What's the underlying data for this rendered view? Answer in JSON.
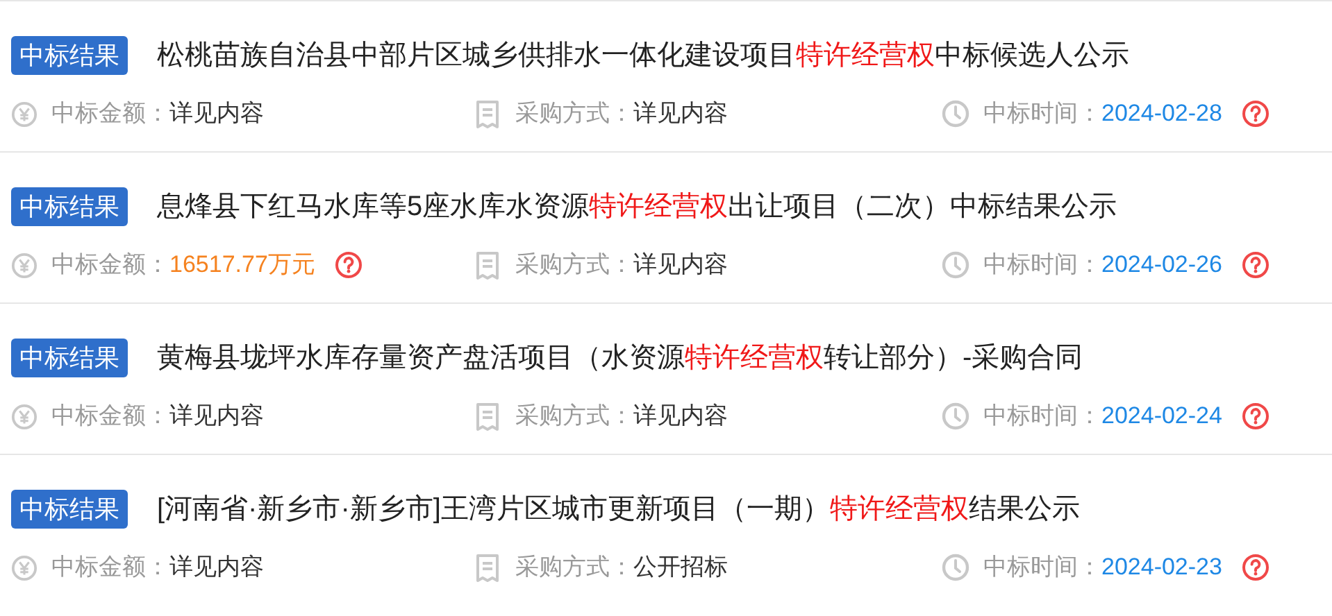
{
  "results": [
    {
      "badge": "中标结果",
      "title": [
        {
          "text": "松桃苗族自治县中部片区城乡供排水一体化建设项目",
          "highlight": false
        },
        {
          "text": "特许经营权",
          "highlight": true
        },
        {
          "text": "中标候选人公示",
          "highlight": false
        }
      ],
      "amount": {
        "label": "中标金额：",
        "value": "详见内容",
        "highlight": false,
        "help": false
      },
      "method": {
        "label": "采购方式：",
        "value": "详见内容"
      },
      "time": {
        "label": "中标时间：",
        "value": "2024-02-28",
        "help": true
      }
    },
    {
      "badge": "中标结果",
      "title": [
        {
          "text": "息烽县下红马水库等5座水库水资源",
          "highlight": false
        },
        {
          "text": "特许经营权",
          "highlight": true
        },
        {
          "text": "出让项目（二次）中标结果公示",
          "highlight": false
        }
      ],
      "amount": {
        "label": "中标金额：",
        "value": "16517.77万元",
        "highlight": true,
        "help": true
      },
      "method": {
        "label": "采购方式：",
        "value": "详见内容"
      },
      "time": {
        "label": "中标时间：",
        "value": "2024-02-26",
        "help": true
      }
    },
    {
      "badge": "中标结果",
      "title": [
        {
          "text": "黄梅县垅坪水库存量资产盘活项目（水资源",
          "highlight": false
        },
        {
          "text": "特许经营权",
          "highlight": true
        },
        {
          "text": "转让部分）-采购合同",
          "highlight": false
        }
      ],
      "amount": {
        "label": "中标金额：",
        "value": "详见内容",
        "highlight": false,
        "help": false
      },
      "method": {
        "label": "采购方式：",
        "value": "详见内容"
      },
      "time": {
        "label": "中标时间：",
        "value": "2024-02-24",
        "help": true
      }
    },
    {
      "badge": "中标结果",
      "title": [
        {
          "text": "[河南省·新乡市·新乡市]王湾片区城市更新项目（一期）",
          "highlight": false
        },
        {
          "text": "特许经营权",
          "highlight": true
        },
        {
          "text": "结果公示",
          "highlight": false
        }
      ],
      "amount": {
        "label": "中标金额：",
        "value": "详见内容",
        "highlight": false,
        "help": false
      },
      "method": {
        "label": "采购方式：",
        "value": "公开招标"
      },
      "time": {
        "label": "中标时间：",
        "value": "2024-02-23",
        "help": true
      }
    }
  ]
}
